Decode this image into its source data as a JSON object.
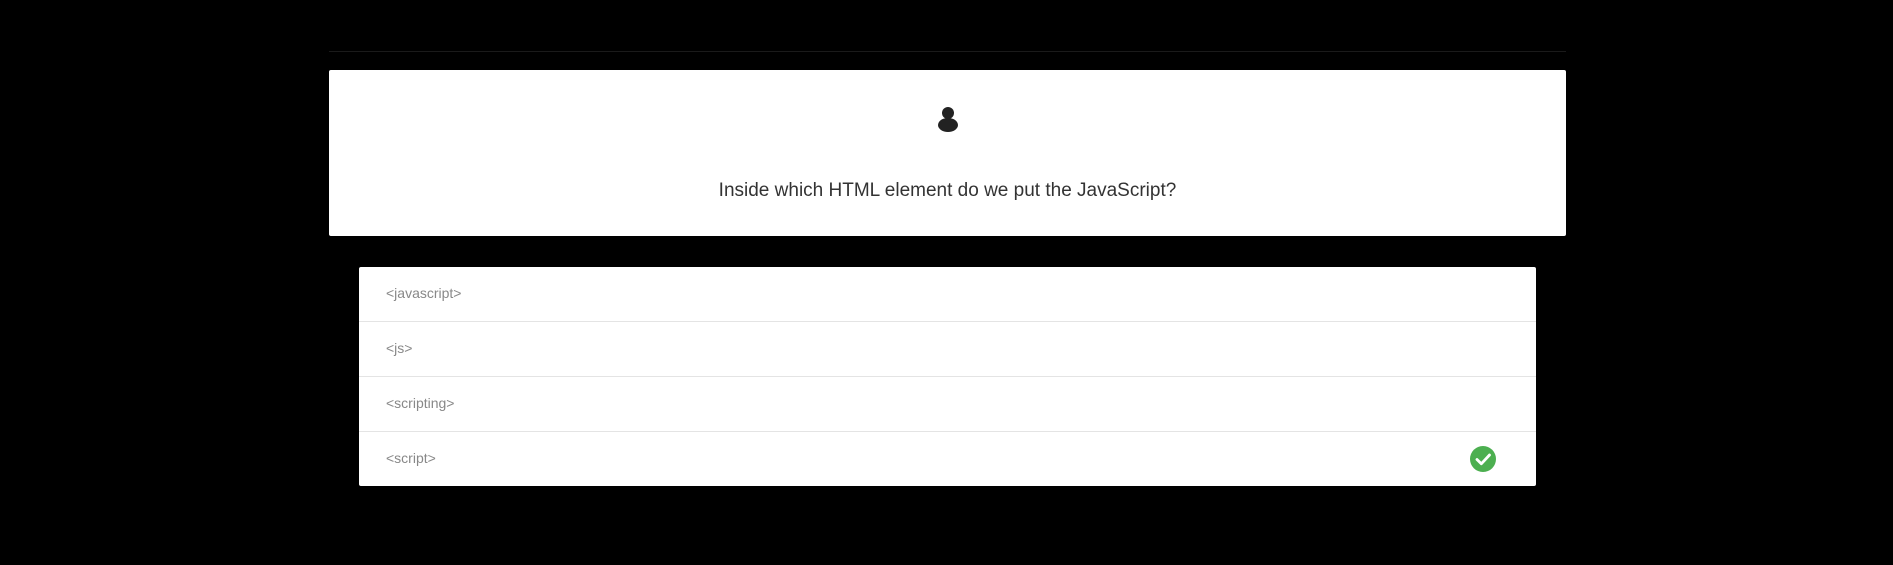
{
  "question": {
    "icon": "person-icon",
    "text": "Inside which HTML element do we put the JavaScript?"
  },
  "answers": [
    {
      "label": "<javascript>",
      "correct": false
    },
    {
      "label": "<js>",
      "correct": false
    },
    {
      "label": "<scripting>",
      "correct": false
    },
    {
      "label": "<script>",
      "correct": true
    }
  ],
  "colors": {
    "background": "#000000",
    "card": "#ffffff",
    "question_text": "#333333",
    "answer_text": "#888888",
    "correct": "#4caf50"
  }
}
